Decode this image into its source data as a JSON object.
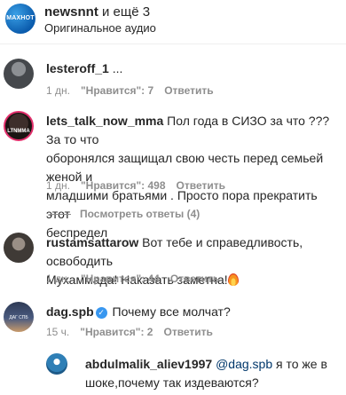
{
  "header": {
    "account": "newsnnt",
    "and_more": " и ещё 3",
    "audio": "Оригинальное аудио",
    "avatar_text": "MAXHOT"
  },
  "comments": [
    {
      "username": "lesteroff_1",
      "text": " ...",
      "age": "1 дн.",
      "likes": "\"Нравится\": 7",
      "reply": "Ответить"
    },
    {
      "username": "lets_talk_now_mma",
      "avatar_text": "LTNMMA",
      "text_line1": " Пол года в СИЗО за что ??? За то что",
      "text_line2": "оборонялся защищал свою честь перед семьей женой и",
      "text_line3": "младшими братьями . Просто пора прекратить этот",
      "text_line4": "беспредел",
      "age": "1 дн.",
      "likes": "\"Нравится\": 498",
      "reply": "Ответить",
      "view_replies": "Посмотреть ответы (4)"
    },
    {
      "username": "rustamsattarow",
      "text_line1": " Вот тебе и справедливость, освободить",
      "text_line2": "Мухаммада! Наказать заметна!",
      "age": "1 дн.",
      "likes": "\"Нравится\": 44",
      "reply": "Ответить"
    },
    {
      "username": "dag.spb",
      "avatar_text": "ДАГ СПБ",
      "text": " Почему все молчат?",
      "age": "15 ч.",
      "likes": "\"Нравится\": 2",
      "reply": "Ответить"
    }
  ],
  "reply": {
    "username": "abdulmalik_aliev1997",
    "mention": "@dag.spb",
    "text_line1": " я то же в",
    "text_line2": "шоке,почему так издеваются?"
  },
  "icons": {
    "verified": "verified-badge-icon",
    "emoji": "fire-emoji-icon"
  },
  "colors": {
    "text": "#262626",
    "meta": "#8e8e8e",
    "mention": "#00376b",
    "verified": "#3897f0",
    "story_ring": "#e1306c"
  }
}
